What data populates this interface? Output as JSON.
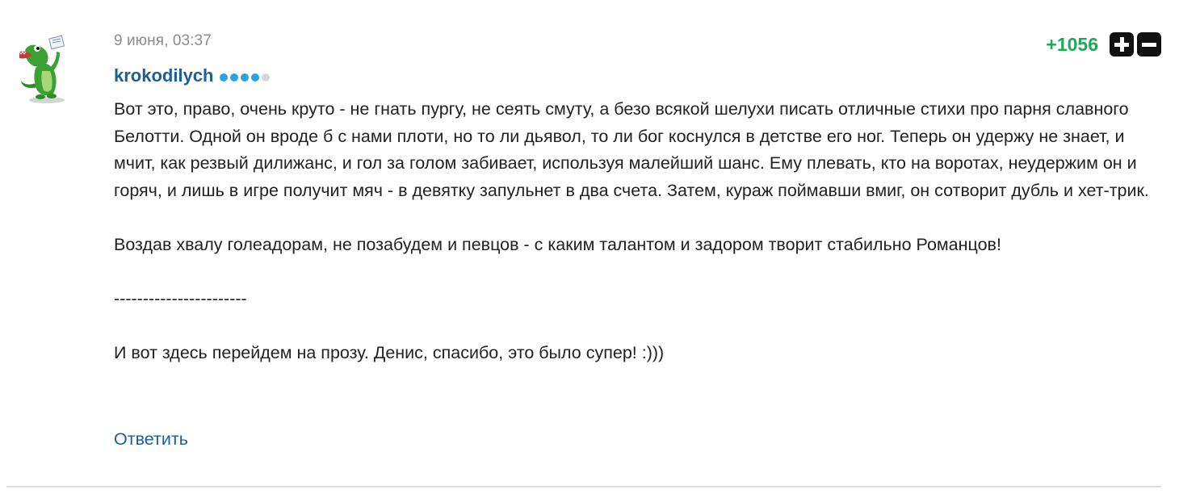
{
  "comment": {
    "date": "9 июня, 03:37",
    "author": "krokodilych",
    "author_rating": {
      "filled": 4,
      "total": 5
    },
    "score": "+1056",
    "paragraphs": [
      "Вот это, право, очень круто - не гнать пургу, не сеять смуту, а безо всякой шелухи писать отличные стихи про парня славного Белотти. Одной он вроде б с нами плоти, но то ли дьявол, то ли бог коснулся в детстве его ног. Теперь он удержу не знает, и мчит, как резвый дилижанс, и гол за голом забивает, используя малейший шанс. Ему плевать, кто на воротах, неудержим он и горяч, и лишь в игре получит мяч - в девятку запульнет в два счета. Затем, кураж поймавши вмиг, он сотворит дубль и хет-трик.",
      "Воздав хвалу голеадорам, не позабудем и певцов - с каким талантом и задором творит стабильно Романцов!",
      "-----------------------",
      "И вот здесь перейдем на прозу. Денис, спасибо, это было супер! :)))"
    ],
    "reply_label": "Ответить",
    "icons": {
      "avatar": "crocodile-avatar",
      "upvote": "plus-icon",
      "downvote": "minus-icon"
    },
    "colors": {
      "author": "#1a5f9a",
      "score": "#21a65a",
      "rating_dot_on": "#2ba1e6",
      "rating_dot_off": "#d6d6d6",
      "date": "#8c8c8c"
    }
  }
}
